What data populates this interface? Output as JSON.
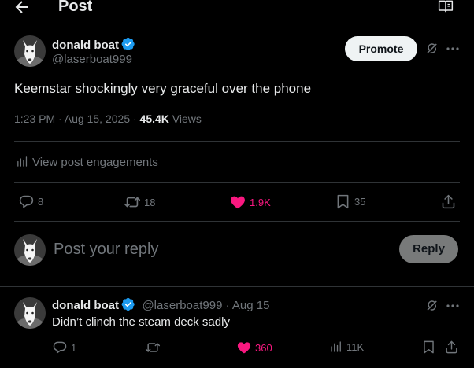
{
  "header": {
    "title": "Post"
  },
  "post": {
    "author_name": "donald boat",
    "author_handle": "@laserboat999",
    "promote_label": "Promote",
    "text": "Keemstar shockingly very graceful over the phone",
    "time": "1:23 PM · Aug 15, 2025 · ",
    "views_count": "45.4K",
    "views_label": " Views",
    "engagements_label": "View post engagements",
    "actions": {
      "replies": "8",
      "reposts": "18",
      "likes": "1.9K",
      "bookmarks": "35"
    }
  },
  "composer": {
    "placeholder": "Post your reply",
    "reply_button": "Reply"
  },
  "reply": {
    "author_name": "donald boat",
    "meta": "@laserboat999 · Aug 15",
    "text": "Didn’t clinch the steam deck sadly",
    "actions": {
      "replies": "1",
      "likes": "360",
      "views": "11K"
    }
  },
  "colors": {
    "background": "#000000",
    "text": "#e7e9ea",
    "muted": "#71767b",
    "like": "#f91880",
    "verified": "#1d9bf0",
    "divider": "#2f3336"
  }
}
